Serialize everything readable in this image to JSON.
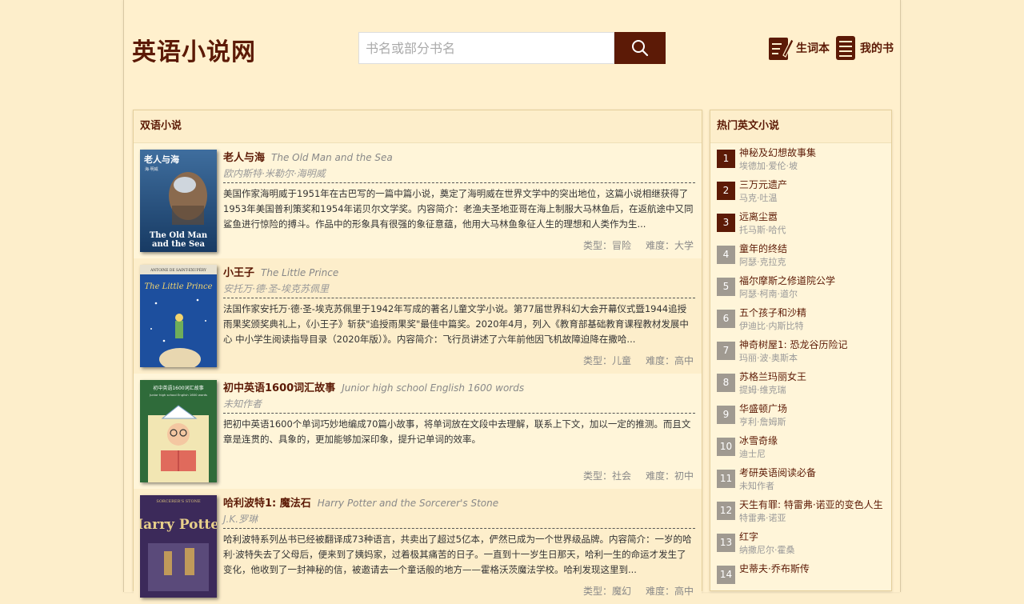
{
  "header": {
    "logo": "英语小说网",
    "search_placeholder": "书名或部分书名",
    "vocab_label": "生词本",
    "mybooks_label": "我的书"
  },
  "left_panel": {
    "title": "双语小说",
    "books": [
      {
        "cn_title": "老人与海",
        "en_title": "The Old Man and the Sea",
        "author": "欧内斯特·米勒尔·海明威",
        "description": "美国作家海明威于1951年在古巴写的一篇中篇小说，奠定了海明威在世界文学中的突出地位，这篇小说相继获得了1953年美国普利策奖和1954年诺贝尔文学奖。内容简介：老渔夫圣地亚哥在海上制服大马林鱼后，在返航途中又同鲨鱼进行惊险的搏斗。作品中的形象具有很强的象征意蕴，他用大马林鱼象征人生的理想和人类作为生...",
        "type": "类型：冒险",
        "level": "难度：大学",
        "cover": {
          "title_cn": "老人与海",
          "title_en": "The Old Man and the Sea",
          "note": "海·明威"
        }
      },
      {
        "cn_title": "小王子",
        "en_title": "The Little Prince",
        "author": "安托万·德·圣-埃克苏佩里",
        "description": "法国作家安托万·德·圣-埃克苏佩里于1942年写成的著名儿童文学小说。第77届世界科幻大会开幕仪式暨1944追授雨果奖颁奖典礼上，《小王子》斩获\"追授雨果奖\"最佳中篇奖。2020年4月，列入《教育部基础教育课程教材发展中心 中小学生阅读指导目录（2020年版）》。内容简介：飞行员讲述了六年前他因飞机故障迫降在撒哈...",
        "type": "类型：儿童",
        "level": "难度：高中",
        "cover": {
          "author": "ANTOINE DE SAINT-EXUPÉRY",
          "title_en": "The Little Prince"
        }
      },
      {
        "cn_title": "初中英语1600词汇故事",
        "en_title": "Junior high school English 1600 words",
        "author": "未知作者",
        "description": "把初中英语1600个单词巧妙地编成70篇小故事，将单词放在文段中去理解，联系上下文，加以一定的推测。而且文章是连贯的、具象的，更加能够加深印象，提升记单词的效率。",
        "type": "类型：社会",
        "level": "难度：初中",
        "cover": {
          "title_cn": "初中英语1600词汇故事",
          "title_en": "Junior high school English 1600 words"
        }
      },
      {
        "cn_title": "哈利波特1: 魔法石",
        "en_title": "Harry Potter and the Sorcerer's Stone",
        "author": "J.K.罗琳",
        "description": "哈利波特系列丛书已经被翻译成73种语言，共卖出了超过5亿本，俨然已成为一个世界级品牌。内容简介：一岁的哈利·波特失去了父母后，便来到了姨妈家，过着极其痛苦的日子。一直到十一岁生日那天，哈利一生的命运才发生了变化，他收到了一封神秘的信，被邀请去一个童话般的地方——霍格沃茨魔法学校。哈利发现这里到...",
        "type": "类型：魔幻",
        "level": "难度：高中",
        "cover": {
          "title_top": "SORCERER'S STONE",
          "title_en": "Harry Potter"
        }
      }
    ]
  },
  "right_panel": {
    "title": "热门英文小说",
    "items": [
      {
        "rank": "1",
        "title": "神秘及幻想故事集",
        "author": "埃德加·爱伦·坡"
      },
      {
        "rank": "2",
        "title": "三万元遗产",
        "author": "马克·吐温"
      },
      {
        "rank": "3",
        "title": "远离尘嚣",
        "author": "托马斯·哈代"
      },
      {
        "rank": "4",
        "title": "童年的终结",
        "author": "阿瑟·克拉克"
      },
      {
        "rank": "5",
        "title": "福尔摩斯之修道院公学",
        "author": "阿瑟·柯南·道尔"
      },
      {
        "rank": "6",
        "title": "五个孩子和沙精",
        "author": "伊迪比·内斯比特"
      },
      {
        "rank": "7",
        "title": "神奇树屋1: 恐龙谷历险记",
        "author": "玛丽·波·奥斯本"
      },
      {
        "rank": "8",
        "title": "苏格兰玛丽女王",
        "author": "提姆·维克瑞"
      },
      {
        "rank": "9",
        "title": "华盛顿广场",
        "author": "亨利·詹姆斯"
      },
      {
        "rank": "10",
        "title": "冰雪奇缘",
        "author": "迪士尼"
      },
      {
        "rank": "11",
        "title": "考研英语阅读必备",
        "author": "未知作者"
      },
      {
        "rank": "12",
        "title": "天生有罪: 特雷弗·诺亚的变色人生",
        "author": "特雷弗·诺亚"
      },
      {
        "rank": "13",
        "title": "红字",
        "author": "纳撒尼尔·霍桑"
      },
      {
        "rank": "14",
        "title": "史蒂夫·乔布斯传",
        "author": ""
      }
    ]
  },
  "colors": {
    "accent": "#5c1a06",
    "page_bg": "#fdeecb",
    "panel_bg": "#fff5d9",
    "rank_gray": "#a09a91"
  }
}
